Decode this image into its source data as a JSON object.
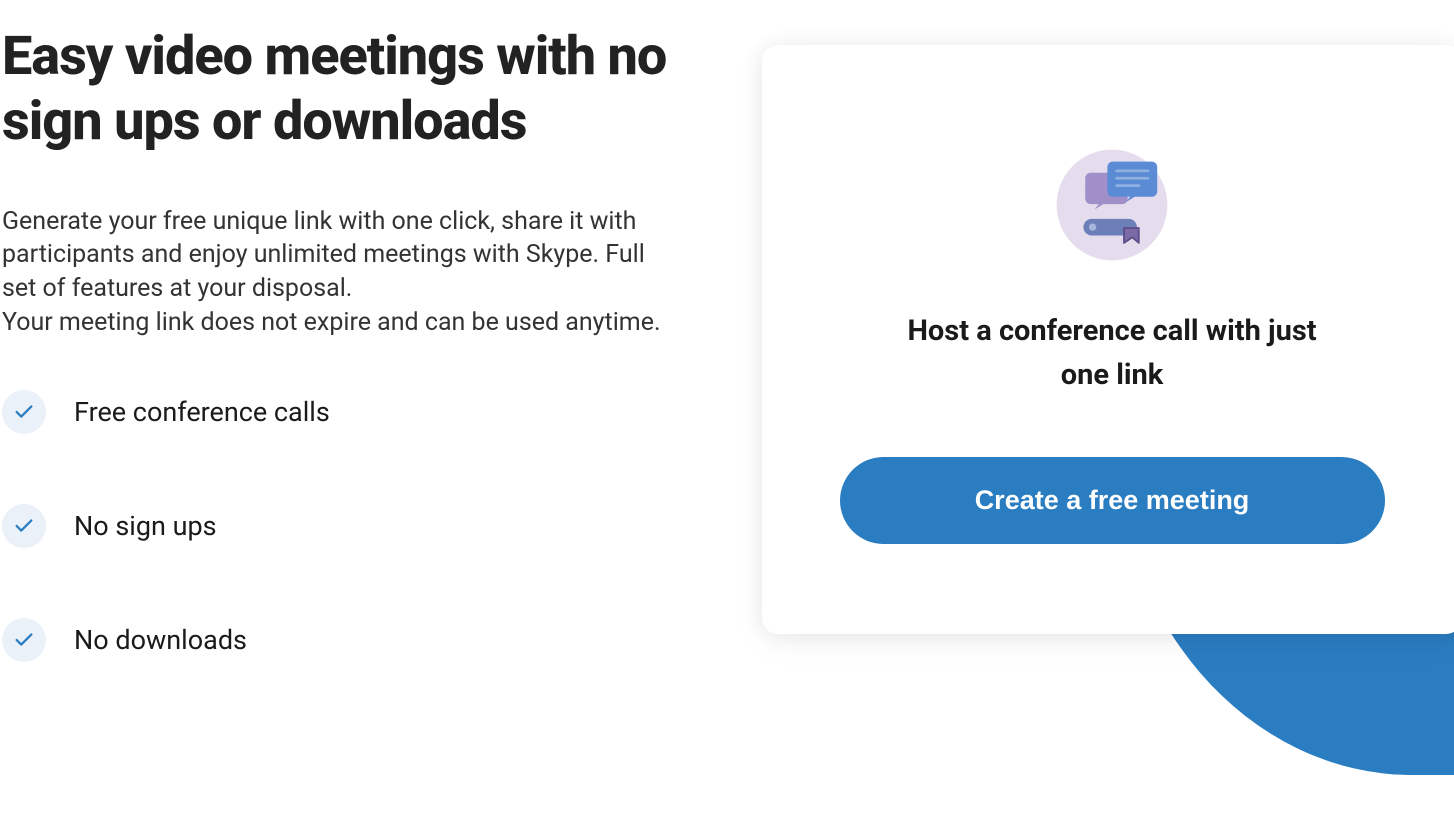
{
  "left": {
    "headline": "Easy video meetings with no sign ups or downloads",
    "description_line1": "Generate your free unique link with one click, share it with participants and enjoy unlimited meetings with Skype. Full set of features at your disposal.",
    "description_line2": "Your meeting link does not expire and can be used anytime.",
    "features": [
      {
        "label": "Free conference calls"
      },
      {
        "label": "No sign ups"
      },
      {
        "label": "No downloads"
      }
    ]
  },
  "card": {
    "title": "Host a conference call with just one link",
    "cta_label": "Create a free meeting"
  },
  "colors": {
    "accent": "#2a7dc1",
    "check_bg": "#eaf1f9"
  }
}
